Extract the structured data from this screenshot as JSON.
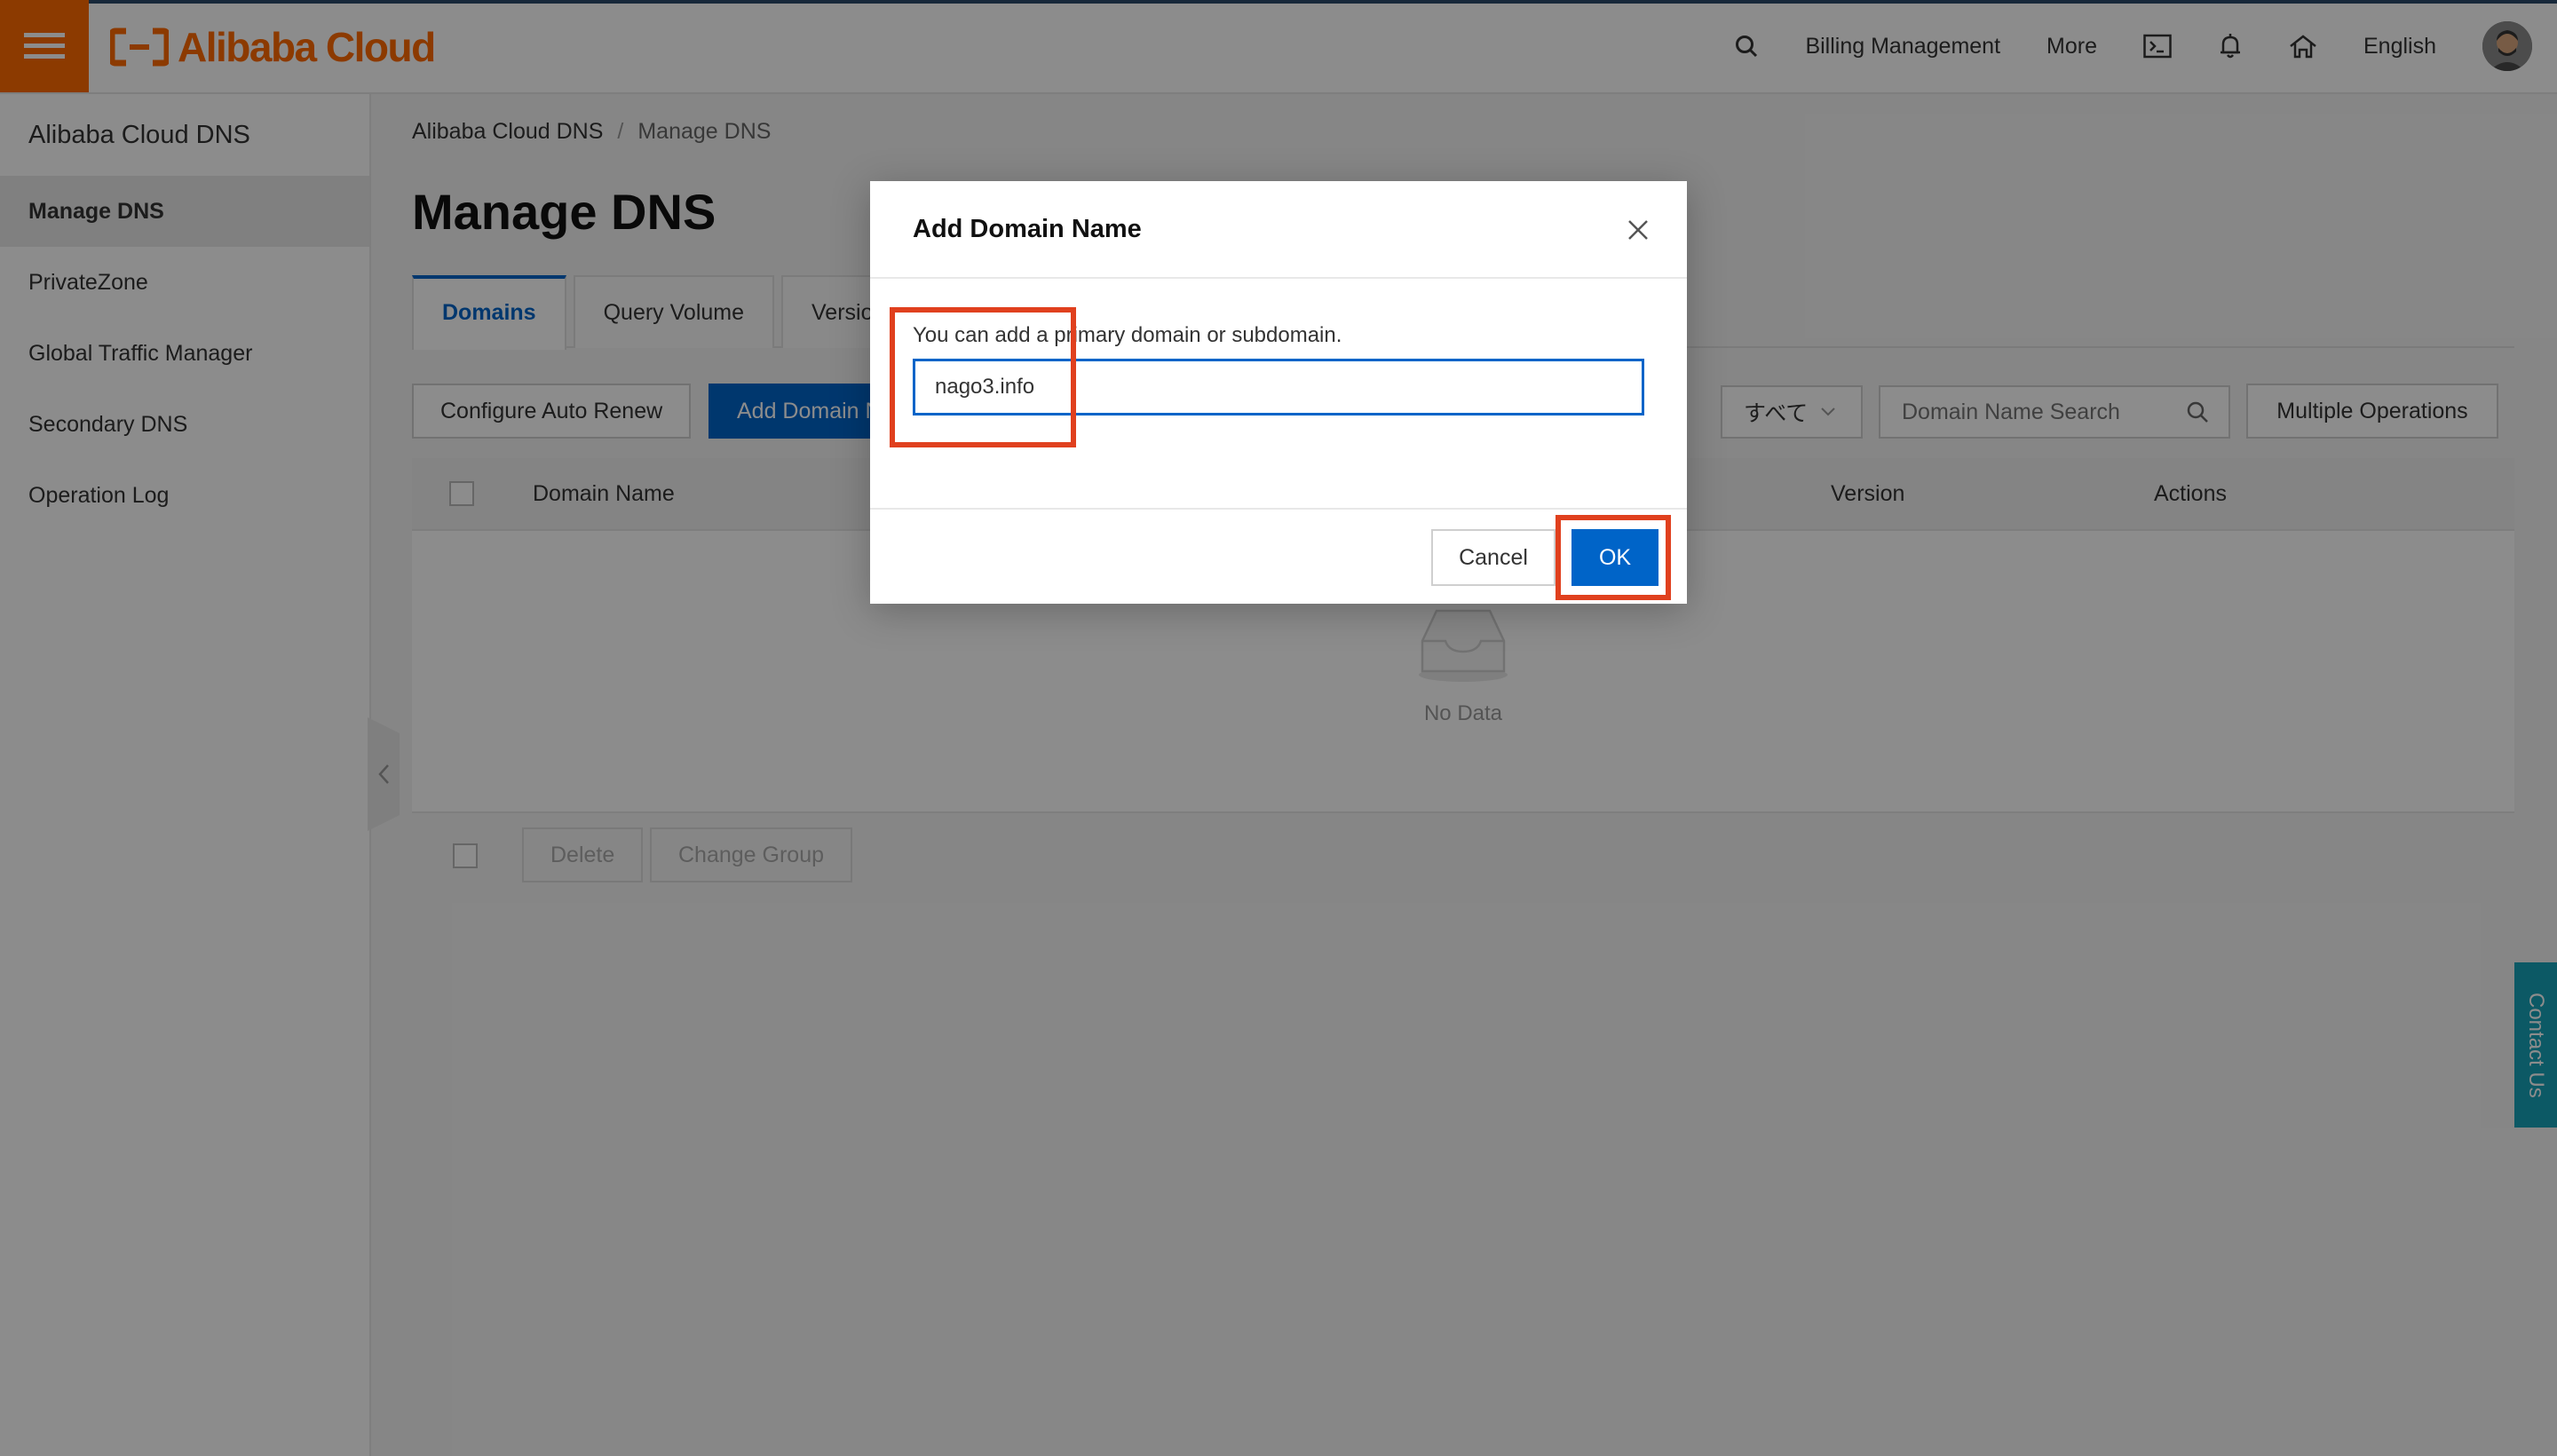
{
  "brand": {
    "name": "Alibaba Cloud",
    "accent_color": "#ff6a00"
  },
  "topnav": {
    "billing": "Billing Management",
    "more": "More",
    "language": "English",
    "icons": [
      "search-icon",
      "terminal-icon",
      "bell-icon",
      "home-icon"
    ]
  },
  "sidebar": {
    "title": "Alibaba Cloud DNS",
    "items": [
      {
        "label": "Manage DNS",
        "active": true
      },
      {
        "label": "PrivateZone"
      },
      {
        "label": "Global Traffic Manager"
      },
      {
        "label": "Secondary DNS"
      },
      {
        "label": "Operation Log"
      }
    ]
  },
  "breadcrumb": {
    "root": "Alibaba Cloud DNS",
    "separator": "/",
    "current": "Manage DNS"
  },
  "page": {
    "title": "Manage DNS"
  },
  "tabs": [
    {
      "label": "Domains",
      "active": true
    },
    {
      "label": "Query Volume"
    },
    {
      "label": "Version"
    }
  ],
  "toolbar": {
    "configure_auto_renew": "Configure Auto Renew",
    "add_domain": "Add Domain N",
    "group_select": "すべて",
    "search_placeholder": "Domain Name Search",
    "multiple_operations": "Multiple Operations"
  },
  "table": {
    "columns": {
      "domain_name": "Domain Name",
      "version": "Version",
      "actions": "Actions"
    },
    "empty_text": "No Data"
  },
  "footer_actions": {
    "delete": "Delete",
    "change_group": "Change Group"
  },
  "contact": {
    "label": "Contact Us"
  },
  "modal": {
    "title": "Add Domain Name",
    "hint": "You can add a primary domain or subdomain.",
    "input_value": "nago3.info",
    "cancel": "Cancel",
    "ok": "OK"
  },
  "colors": {
    "primary": "#0064c8",
    "annotation": "#e0401e",
    "contact": "#17a2b8"
  }
}
